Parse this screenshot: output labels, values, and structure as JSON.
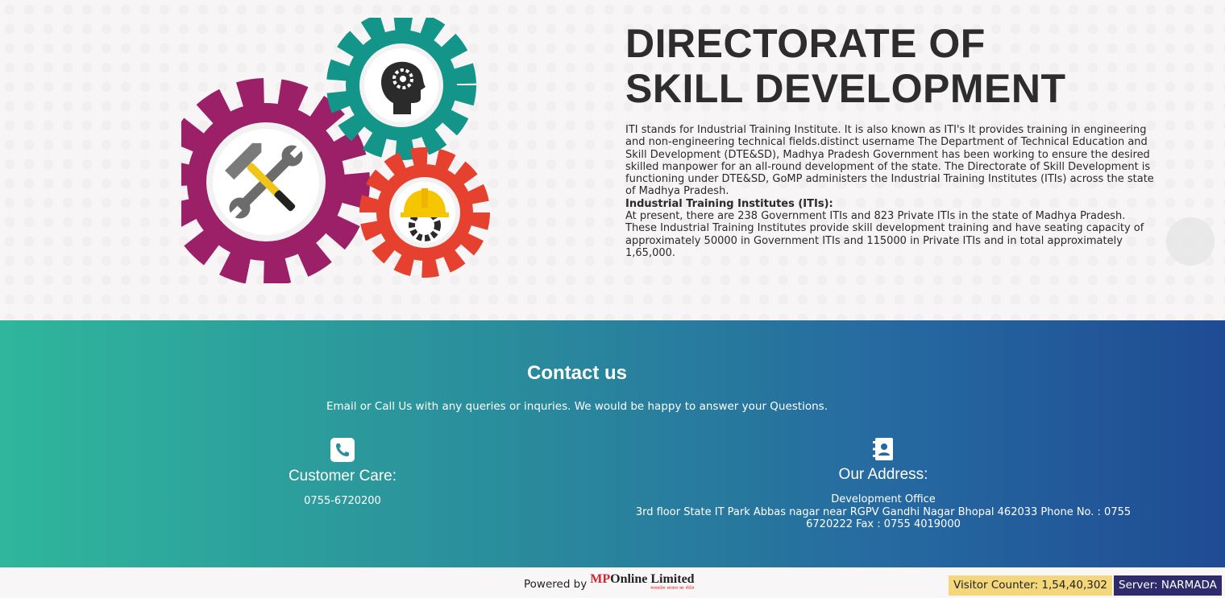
{
  "about": {
    "title_line1": "DIRECTORATE OF",
    "title_line2": "SKILL DEVELOPMENT",
    "paragraph1": "ITI stands for Industrial Training Institute. It is also known as ITI's It provides training in engineering and non-engineering technical fields.distinct username The Department of Technical Education and Skill Development (DTE&SD), Madhya Pradesh Government has been working to ensure the desired skilled manpower for an all-round development of the state. The Directorate of Skill Development is functioning under DTE&SD, GoMP administers the Industrial Training Institutes (ITIs) across the state of Madhya Pradesh.",
    "subheading": "Industrial Training Institutes (ITIs):",
    "paragraph2": "At present, there are 238 Government ITIs and 823 Private ITIs in the state of Madhya Pradesh. These Industrial Training Institutes provide skill development training and have seating capacity of approximately 50000 in Government ITIs and 115000 in Private ITIs and in total approximately 1,65,000."
  },
  "contact": {
    "title": "Contact us",
    "subtitle": "Email or Call Us with any queries or inquries. We would be happy to answer your Questions.",
    "customer_care": {
      "icon": "phone-icon",
      "title": "Customer Care:",
      "phone": "0755-6720200"
    },
    "address": {
      "icon": "contact-book-icon",
      "title": "Our Address:",
      "line1": "Development Office",
      "line2": "3rd floor State IT Park Abbas nagar near RGPV Gandhi Nagar Bhopal 462033 Phone No. : 0755 6720222 Fax : 0755 4019000"
    }
  },
  "footer": {
    "powered_by": "Powered by",
    "logo_text": "MPOnline Limited",
    "logo_subtext": "मध्यप्रदेश सरकार का पोर्टल",
    "visitor_counter": "Visitor Counter: 1,54,40,302",
    "server": "Server: NARMADA"
  },
  "colors": {
    "gear_purple": "#9b2068",
    "gear_teal": "#13958a",
    "gear_red": "#e6402e",
    "contact_gradient_start": "#2fb69c",
    "contact_gradient_end": "#1f4b93",
    "visitor_bg": "#f3d77a",
    "server_bg": "#2f2a6b"
  }
}
